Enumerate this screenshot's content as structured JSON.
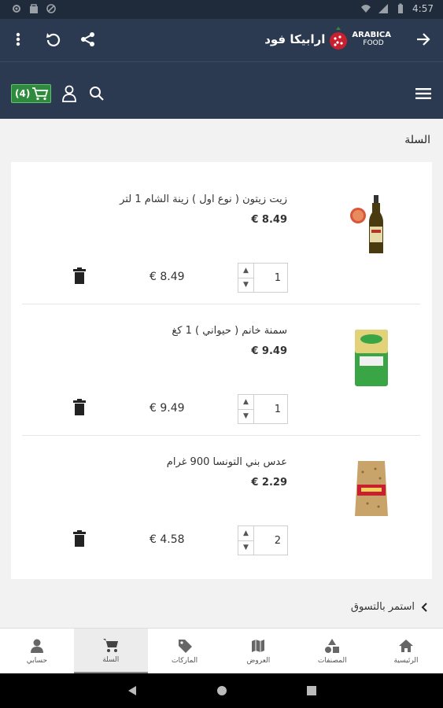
{
  "status_bar": {
    "time": "4:57"
  },
  "header": {
    "logo_arabic": "ارابيكا فود",
    "logo_en_line1": "ARABICA",
    "logo_en_line2": "FOOD",
    "cart_count": "(4)"
  },
  "page": {
    "title": "السلة"
  },
  "cart": {
    "items": [
      {
        "name": "زيت زيتون ( نوع اول ) زينة الشام 1 لتر",
        "price": "€ 8.49",
        "quantity": "1",
        "total": "€ 8.49"
      },
      {
        "name": "سمنة خانم ( حيواني ) 1 كغ",
        "price": "€ 9.49",
        "quantity": "1",
        "total": "€ 9.49"
      },
      {
        "name": "عدس بني التونسا 900 غرام",
        "price": "€ 2.29",
        "quantity": "2",
        "total": "€ 4.58"
      }
    ]
  },
  "continue_label": "استمر بالتسوق",
  "bottom_nav": {
    "items": [
      {
        "label": "حسابي",
        "icon": "person-icon"
      },
      {
        "label": "السلة",
        "icon": "cart-icon"
      },
      {
        "label": "الماركات",
        "icon": "tag-icon"
      },
      {
        "label": "العروض",
        "icon": "map-icon"
      },
      {
        "label": "المصنفات",
        "icon": "shapes-icon"
      },
      {
        "label": "الرئيسية",
        "icon": "home-icon"
      }
    ]
  },
  "colors": {
    "header": "#2b3a50",
    "cart_badge": "#2e8b3e",
    "brand_red": "#c8202f"
  }
}
